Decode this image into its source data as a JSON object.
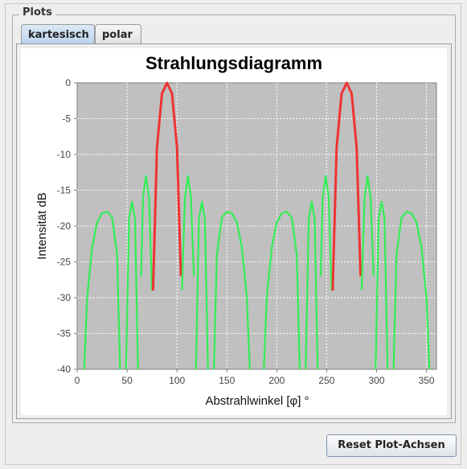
{
  "plots_group": {
    "title": "Plots"
  },
  "tabs": [
    {
      "label": "kartesisch",
      "active": true
    },
    {
      "label": "polar",
      "active": false
    }
  ],
  "reset_button": {
    "label": "Reset Plot-Achsen"
  },
  "chart_data": {
    "type": "line",
    "title": "Strahlungsdiagramm",
    "xlabel": "Abstrahlwinkel [φ] °",
    "ylabel": "Intensität dB",
    "xlim": [
      0,
      360
    ],
    "ylim": [
      -40,
      0
    ],
    "xticks": [
      0,
      50,
      100,
      150,
      200,
      250,
      300,
      350
    ],
    "yticks": [
      0,
      -5,
      -10,
      -15,
      -20,
      -25,
      -30,
      -35,
      -40
    ],
    "grid": true,
    "plot_background": "#c0c0c0",
    "colors": {
      "main_lobe": "#ee3333",
      "side_lobe": "#33ee55"
    },
    "series": [
      {
        "lobe": "side",
        "x": [
          7,
          10,
          15,
          20,
          25,
          30,
          35,
          40,
          43
        ],
        "y": [
          -40,
          -30,
          -23,
          -19.5,
          -18.2,
          -18,
          -18.8,
          -24,
          -40
        ]
      },
      {
        "lobe": "side",
        "x": [
          49,
          52,
          55,
          58,
          61
        ],
        "y": [
          -40,
          -19,
          -16.6,
          -19,
          -40
        ]
      },
      {
        "lobe": "side",
        "x": [
          64,
          66,
          69,
          72,
          75
        ],
        "y": [
          -27,
          -16,
          -13,
          -16,
          -29
        ]
      },
      {
        "lobe": "main",
        "x": [
          76,
          80,
          85,
          90,
          95,
          100,
          104
        ],
        "y": [
          -29,
          -9,
          -1.5,
          0,
          -1.5,
          -9,
          -27
        ]
      },
      {
        "lobe": "side",
        "x": [
          105,
          108,
          111,
          114,
          117
        ],
        "y": [
          -29,
          -16,
          -13,
          -16,
          -27
        ]
      },
      {
        "lobe": "side",
        "x": [
          119,
          122,
          125,
          128,
          131
        ],
        "y": [
          -40,
          -19,
          -16.6,
          -19,
          -40
        ]
      },
      {
        "lobe": "side",
        "x": [
          137,
          140,
          145,
          150,
          155,
          160,
          165,
          170,
          173
        ],
        "y": [
          -40,
          -24,
          -18.8,
          -18,
          -18.2,
          -19.5,
          -23,
          -30,
          -40
        ]
      },
      {
        "lobe": "side",
        "x": [
          187,
          190,
          195,
          200,
          205,
          210,
          215,
          220,
          223
        ],
        "y": [
          -40,
          -30,
          -23,
          -19.5,
          -18.2,
          -18,
          -18.8,
          -24,
          -40
        ]
      },
      {
        "lobe": "side",
        "x": [
          229,
          232,
          235,
          238,
          241
        ],
        "y": [
          -40,
          -19,
          -16.6,
          -19,
          -40
        ]
      },
      {
        "lobe": "side",
        "x": [
          244,
          246,
          249,
          252,
          255
        ],
        "y": [
          -27,
          -16,
          -13,
          -16,
          -29
        ]
      },
      {
        "lobe": "main",
        "x": [
          256,
          260,
          265,
          270,
          275,
          280,
          284
        ],
        "y": [
          -29,
          -9,
          -1.5,
          0,
          -1.5,
          -9,
          -27
        ]
      },
      {
        "lobe": "side",
        "x": [
          285,
          288,
          291,
          294,
          297
        ],
        "y": [
          -29,
          -16,
          -13,
          -16,
          -27
        ]
      },
      {
        "lobe": "side",
        "x": [
          299,
          302,
          305,
          308,
          311
        ],
        "y": [
          -40,
          -19,
          -16.6,
          -19,
          -40
        ]
      },
      {
        "lobe": "side",
        "x": [
          317,
          320,
          325,
          330,
          335,
          340,
          345,
          350,
          353
        ],
        "y": [
          -40,
          -24,
          -18.8,
          -18,
          -18.2,
          -19.5,
          -23,
          -30,
          -40
        ]
      }
    ]
  }
}
